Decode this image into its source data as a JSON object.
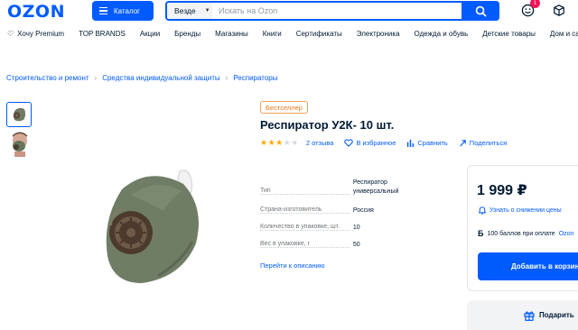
{
  "header": {
    "logo": "OZON",
    "catalog_label": "Каталог",
    "search_scope": "Везде",
    "search_placeholder": "Искать на Ozon",
    "cart_badge": "1"
  },
  "nav": {
    "items": [
      "Хочу Premium",
      "TOP BRANDS",
      "Акции",
      "Бренды",
      "Магазины",
      "Книги",
      "Сертификаты",
      "Электроника",
      "Одежда и обувь",
      "Детские товары",
      "Дом и сад"
    ]
  },
  "breadcrumbs": [
    "Строительство и ремонт",
    "Средства индивидуальной защиты",
    "Респираторы"
  ],
  "product": {
    "badge": "Бестселлер",
    "title": "Респиратор У2К- 10 шт.",
    "rating_stars": 3,
    "reviews": "2 отзыва",
    "favorite": "В избранное",
    "compare": "Сравнить",
    "share": "Поделиться",
    "specs": [
      {
        "key": "Тип",
        "value": "Респиратор универсальный"
      },
      {
        "key": "Страна-изготовитель",
        "value": "Россия"
      },
      {
        "key": "Количество в упаковке, шт.",
        "value": "10"
      },
      {
        "key": "Вес в упаковке, г",
        "value": "50"
      }
    ],
    "description_link": "Перейти к описанию"
  },
  "buy_box": {
    "price": "1 999 ₽",
    "notify": "Узнать о снижении цены",
    "bonus_icon": "Б",
    "bonus_text": "100 баллов при оплате",
    "bonus_link": "Ozon",
    "add_to_cart": "Добавить в корзину",
    "gift": "Подарить"
  },
  "colors": {
    "accent": "#005bff",
    "badge_orange": "#e67817",
    "star": "#ffa800",
    "notification": "#f91155"
  },
  "icons": [
    "menu-icon",
    "search-icon",
    "smiley-icon",
    "box-icon",
    "heart-icon",
    "bell-icon",
    "gift-icon",
    "compare-icon",
    "share-icon"
  ]
}
